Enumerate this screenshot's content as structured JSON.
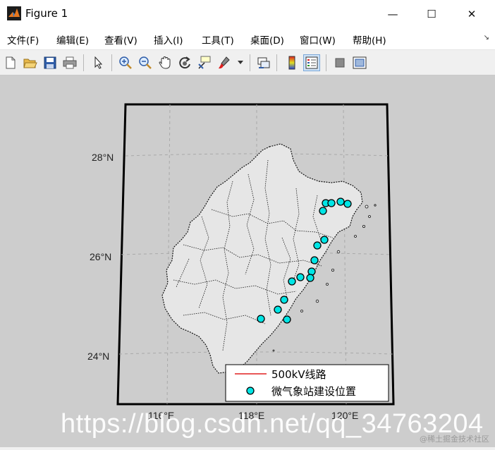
{
  "window": {
    "title": "Figure 1",
    "minimize_glyph": "—",
    "maximize_glyph": "☐",
    "close_glyph": "✕"
  },
  "menu": {
    "items": [
      "文件(F)",
      "编辑(E)",
      "查看(V)",
      "插入(I)",
      "工具(T)",
      "桌面(D)",
      "窗口(W)",
      "帮助(H)"
    ],
    "dock_glyph": "↘"
  },
  "toolbar": {
    "tools": [
      "new-figure-icon",
      "open-file-icon",
      "save-icon",
      "print-icon",
      "pointer-icon",
      "zoom-in-icon",
      "zoom-out-icon",
      "pan-hand-icon",
      "rotate-3d-icon",
      "data-cursor-icon",
      "brush-icon",
      "link-plot-icon",
      "colorbar-icon",
      "legend-icon",
      "hide-plot-tools-icon",
      "show-plot-tools-icon"
    ],
    "active_tool": "legend-icon"
  },
  "map": {
    "lat_labels": [
      "28°N",
      "26°N",
      "24°N"
    ],
    "lon_labels": [
      "116°E",
      "118°E",
      "120°E"
    ],
    "legend": {
      "line_label": "500kV线路",
      "marker_label": "微气象站建设位置"
    },
    "colors": {
      "figure_bg": "#cdcdcd",
      "land": "#e6e6e6",
      "line": "#e02020",
      "marker": "#00e5e5"
    }
  },
  "watermark": {
    "main": "https://blog.csdn.net/qq_34763204",
    "corner": "@稀土掘金技术社区"
  }
}
